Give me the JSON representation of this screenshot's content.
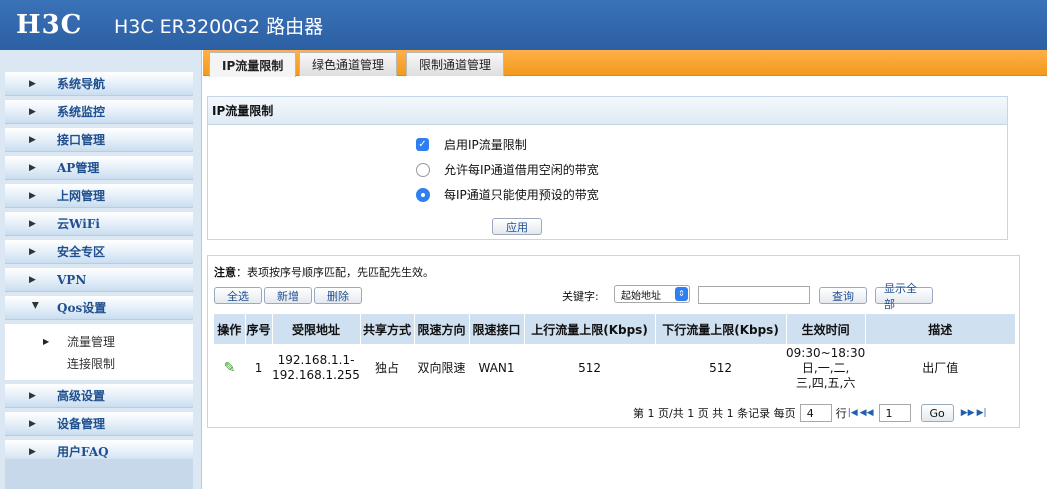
{
  "header": {
    "logo": "H3C",
    "title": "H3C ER3200G2 路由器"
  },
  "sidebar": {
    "items_top": [
      {
        "label": "系统导航"
      },
      {
        "label": "系统监控"
      },
      {
        "label": "接口管理"
      },
      {
        "label": "AP管理"
      },
      {
        "label": "上网管理"
      },
      {
        "label": "云WiFi"
      },
      {
        "label": "安全专区"
      },
      {
        "label": "VPN"
      }
    ],
    "qos": {
      "label": "Qos设置",
      "sub": [
        {
          "label": "流量管理"
        },
        {
          "label": "连接限制"
        }
      ]
    },
    "items_bottom": [
      {
        "label": "高级设置"
      },
      {
        "label": "设备管理"
      },
      {
        "label": "用户FAQ"
      }
    ]
  },
  "tabs": [
    {
      "label": "IP流量限制"
    },
    {
      "label": "绿色通道管理"
    },
    {
      "label": "限制通道管理"
    }
  ],
  "panel1": {
    "title": "IP流量限制",
    "opt_enable": "启用IP流量限制",
    "opt_borrow": "允许每IP通道借用空闲的带宽",
    "opt_preset": "每IP通道只能使用预设的带宽",
    "apply": "应用"
  },
  "panel2": {
    "note_label": "注意",
    "note_text": "：表项按序号顺序匹配，先匹配先生效。",
    "btn_select_all": "全选",
    "btn_add": "新增",
    "btn_delete": "删除",
    "keyword_label": "关键字:",
    "keyword_select": "起始地址",
    "search_value": "",
    "btn_query": "查询",
    "btn_show_all": "显示全部",
    "columns": [
      "操作",
      "序号",
      "受限地址",
      "共享方式",
      "限速方向",
      "限速接口",
      "上行流量上限(Kbps)",
      "下行流量上限(Kbps)",
      "生效时间",
      "描述"
    ],
    "rows": [
      {
        "index": "1",
        "addr1": "192.168.1.1-",
        "addr2": "192.168.1.255",
        "share": "独占",
        "direction": "双向限速",
        "iface": "WAN1",
        "up": "512",
        "down": "512",
        "time1": "09:30~18:30",
        "time2": "日,一,二,",
        "time3": "三,四,五,六",
        "desc": "出厂值"
      }
    ],
    "pager": {
      "text1": "第 1 页/共 1 页 共 1 条记录 每页",
      "per_page": "4",
      "text2": "行",
      "page": "1",
      "go": "Go"
    }
  }
}
